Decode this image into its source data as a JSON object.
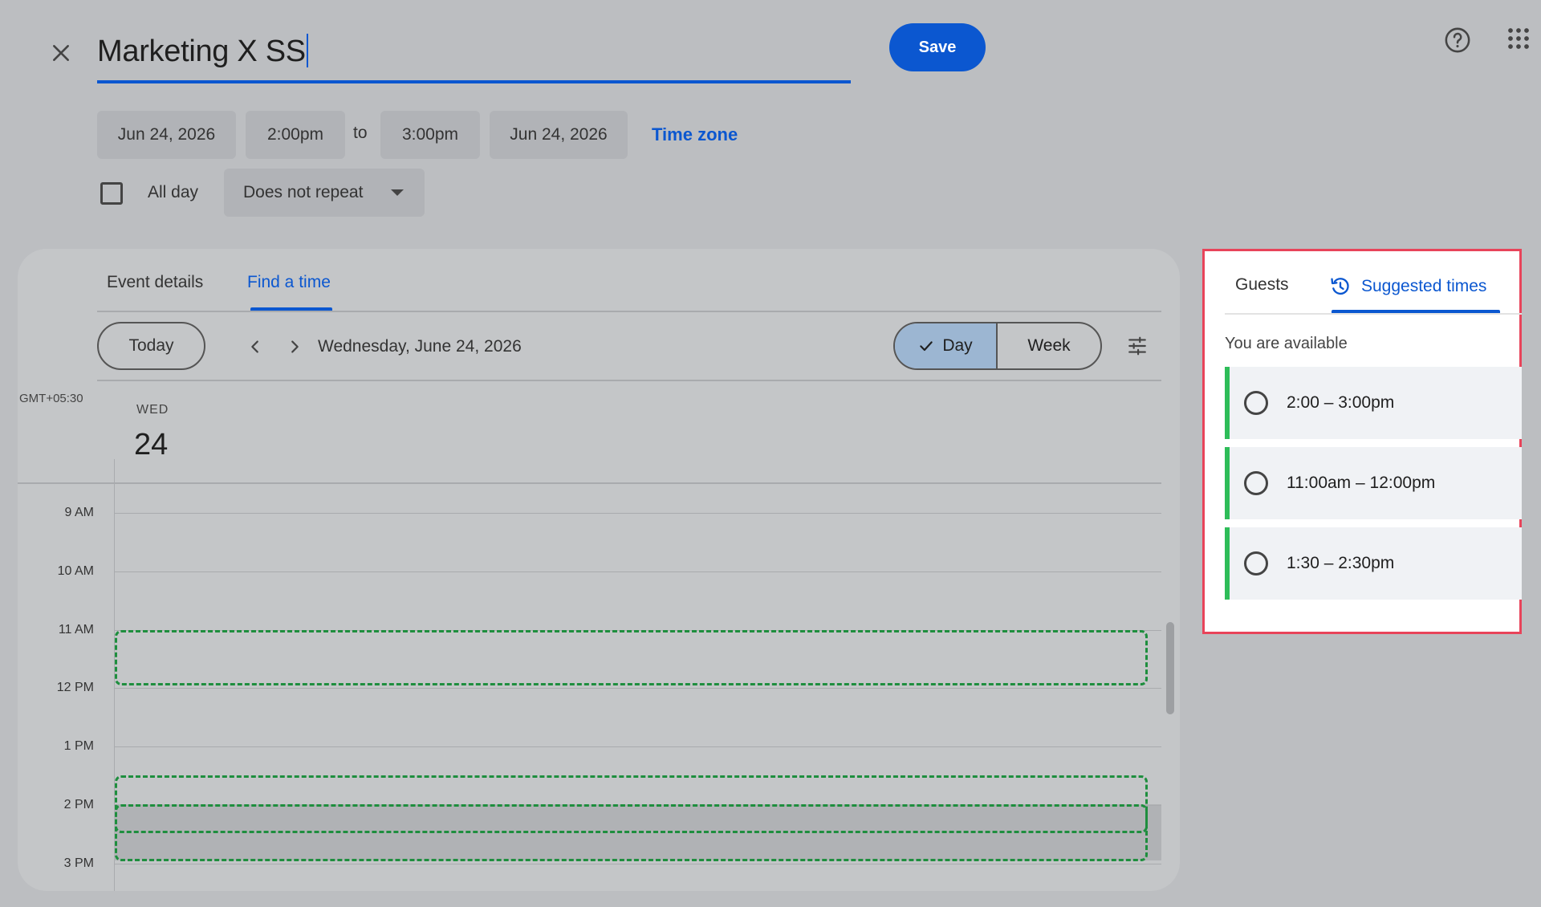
{
  "header": {
    "title": "Marketing X SS",
    "save_label": "Save",
    "close_icon": "close-icon",
    "help_icon": "help-icon",
    "apps_icon": "apps-grid-icon"
  },
  "datetime": {
    "start_date": "Jun 24, 2026",
    "start_time": "2:00pm",
    "to_label": "to",
    "end_time": "3:00pm",
    "end_date": "Jun 24, 2026",
    "timezone_link": "Time zone",
    "all_day_label": "All day",
    "all_day_checked": false,
    "repeat_value": "Does not repeat"
  },
  "tabs": {
    "event_details": "Event details",
    "find_a_time": "Find a time",
    "active": "find_a_time"
  },
  "toolbar": {
    "today_label": "Today",
    "date_label": "Wednesday, June 24, 2026",
    "day_label": "Day",
    "week_label": "Week",
    "active_view": "Day"
  },
  "calendar": {
    "timezone": "GMT+05:30",
    "weekday": "WED",
    "day_number": "24",
    "hours": [
      "9 AM",
      "10 AM",
      "11 AM",
      "12 PM",
      "1 PM",
      "2 PM",
      "3 PM"
    ]
  },
  "right_panel": {
    "guests_tab": "Guests",
    "suggested_tab": "Suggested times",
    "available_label": "You are available",
    "suggestions": [
      {
        "label": "2:00 – 3:00pm"
      },
      {
        "label": "11:00am – 12:00pm"
      },
      {
        "label": "1:30 – 2:30pm"
      }
    ]
  },
  "colors": {
    "accent": "#0b57d0",
    "available_green": "#2ebd59",
    "highlight_border": "#e8445a"
  }
}
